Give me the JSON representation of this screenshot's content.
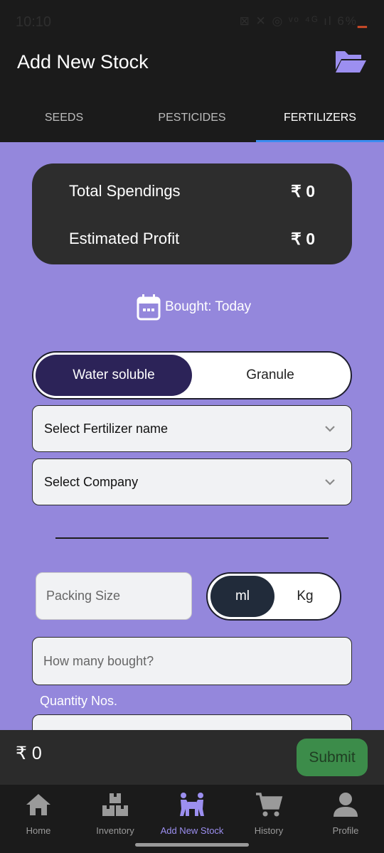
{
  "status": {
    "time": "10:10",
    "icons": "⊠ ✕ ◎ ᵛᵒ ⁴ᴳ ıl 6%",
    "battery": "▁"
  },
  "header": {
    "title": "Add New Stock"
  },
  "tabs": [
    {
      "label": "SEEDS"
    },
    {
      "label": "PESTICIDES"
    },
    {
      "label": "FERTILIZERS",
      "active": true
    }
  ],
  "summary": {
    "spend_label": "Total Spendings",
    "spend_value": "₹ 0",
    "profit_label": "Estimated Profit",
    "profit_value": "₹ 0"
  },
  "bought": {
    "label": "Bought: Today"
  },
  "fert_type": {
    "options": [
      "Water soluble",
      "Granule"
    ],
    "selected": "Water soluble"
  },
  "fertilizer_select": {
    "value": "Select Fertilizer name"
  },
  "company_select": {
    "value": "Select Company"
  },
  "packing": {
    "placeholder": "Packing Size"
  },
  "unit": {
    "options": [
      "ml",
      "Kg"
    ],
    "selected": "ml"
  },
  "quantity": {
    "placeholder": "How many bought?",
    "label": "Quantity Nos."
  },
  "footer": {
    "total": "₹ 0",
    "submit_label": "Submit"
  },
  "nav": [
    {
      "label": "Home",
      "icon": "home-icon"
    },
    {
      "label": "Inventory",
      "icon": "boxes-icon"
    },
    {
      "label": "Add New Stock",
      "icon": "people-carry-icon",
      "active": true
    },
    {
      "label": "History",
      "icon": "cart-icon"
    },
    {
      "label": "Profile",
      "icon": "user-icon"
    }
  ],
  "colors": {
    "background": "#9487dc",
    "accent": "#9c8ff0",
    "tab_indicator": "#3b8cf0",
    "submit": "#3c8c4a"
  }
}
